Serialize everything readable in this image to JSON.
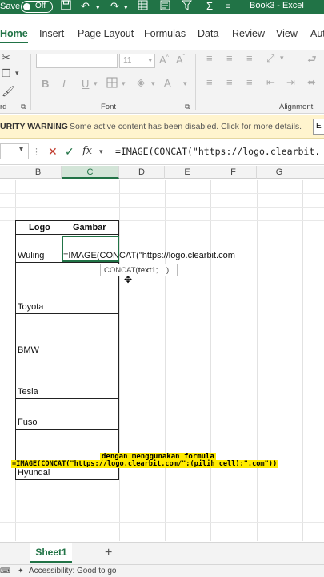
{
  "titlebar": {
    "autosave_label": "Save",
    "toggle_label": "Off",
    "book_title": "Book3 - Excel",
    "accent_color": "#217346"
  },
  "ribbon_tabs": [
    "Home",
    "Insert",
    "Page Layout",
    "Formulas",
    "Data",
    "Review",
    "View",
    "Aut"
  ],
  "ribbon": {
    "font_size_value": "11",
    "group_font_label": "Font",
    "group_alignment_label": "Alignment",
    "group_clipboard_label": "rd"
  },
  "security_bar": {
    "warning_label": "URITY WARNING",
    "message": "Some active content has been disabled. Click for more details.",
    "button_label": "E"
  },
  "formula_bar": {
    "fx_label": "fx",
    "formula_text": "=IMAGE(CONCAT(\"https://logo.clearbit."
  },
  "columns": [
    "B",
    "C",
    "D",
    "E",
    "F",
    "G"
  ],
  "selected_column": "C",
  "table": {
    "header_logo": "Logo",
    "header_gambar": "Gambar",
    "rows": [
      "Wuling",
      "Toyota",
      "BMW",
      "Tesla",
      "Fuso",
      "Hyundai"
    ]
  },
  "editing": {
    "cell_text": "=IMAGE(CONCAT(\"https://logo.clearbit.com",
    "tooltip_fn": "CONCAT(",
    "tooltip_arg": "text1",
    "tooltip_rest": "; ...)"
  },
  "caption": {
    "line1": "dengan menggunakan formula",
    "line2": "=IMAGE(CONCAT(\"https://logo.clearbit.com/\";(pilih cell);\".com\"))"
  },
  "sheet_tab": "Sheet1",
  "status": {
    "accessibility": "Accessibility: Good to go"
  }
}
